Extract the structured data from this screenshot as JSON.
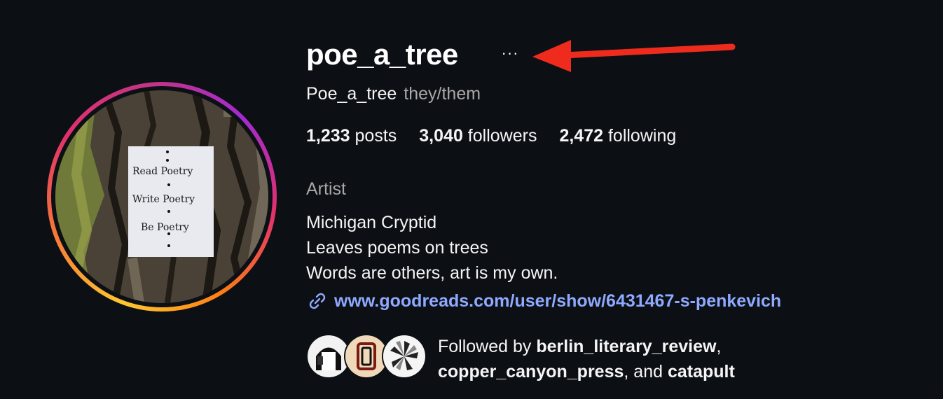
{
  "profile": {
    "username": "poe_a_tree",
    "more_icon": "more-horizontal-icon",
    "display_name": "Poe_a_tree",
    "pronouns": "they/them",
    "category": "Artist",
    "bio_lines": [
      "Michigan Cryptid",
      "Leaves poems on trees",
      "Words are others, art is my own."
    ],
    "link": "www.goodreads.com/user/show/6431467-s-penkevich",
    "link_icon": "link-chain-icon"
  },
  "stats": {
    "posts_count": "1,233",
    "posts_label": "posts",
    "followers_count": "3,040",
    "followers_label": "followers",
    "following_count": "2,472",
    "following_label": "following"
  },
  "avatar": {
    "sign_lines": [
      "Read Poetry",
      "Write Poetry",
      "Be Poetry"
    ]
  },
  "followed_by": {
    "prefix": "Followed by",
    "user1": "berlin_literary_review",
    "sep1": ",",
    "user2": "copper_canyon_press",
    "sep2": ", and",
    "user3": "catapult"
  },
  "colors": {
    "background": "#0c0f14",
    "link": "#8fa9ff",
    "secondary_text": "#a8a8a8",
    "annotation_arrow": "#ef2b1d"
  }
}
